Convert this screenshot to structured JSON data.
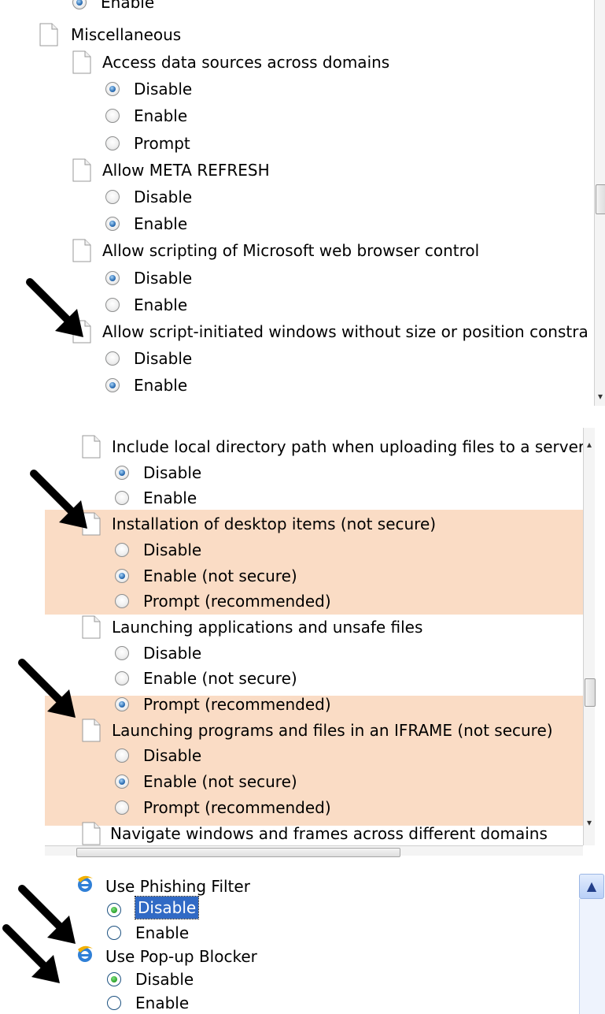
{
  "panel1": {
    "cut_top": "Enable",
    "category": "Miscellaneous",
    "settings": [
      {
        "title": "Access data sources across domains",
        "options": [
          "Disable",
          "Enable",
          "Prompt"
        ],
        "selected": 0
      },
      {
        "title": "Allow META REFRESH",
        "options": [
          "Disable",
          "Enable"
        ],
        "selected": 1
      },
      {
        "title": "Allow scripting of Microsoft web browser control",
        "options": [
          "Disable",
          "Enable"
        ],
        "selected": 0
      },
      {
        "title": "Allow script-initiated windows without size or position constra",
        "options": [
          "Disable",
          "Enable"
        ],
        "selected": 1
      }
    ]
  },
  "panel2": {
    "settings": [
      {
        "title": "Include local directory path when uploading files to a server",
        "options": [
          "Disable",
          "Enable"
        ],
        "selected": 0,
        "highlighted": false
      },
      {
        "title": "Installation of desktop items (not secure)",
        "options": [
          "Disable",
          "Enable (not secure)",
          "Prompt (recommended)"
        ],
        "selected": 1,
        "highlighted": true
      },
      {
        "title": "Launching applications and unsafe files",
        "options": [
          "Disable",
          "Enable (not secure)",
          "Prompt (recommended)"
        ],
        "selected": 2,
        "highlighted": false
      },
      {
        "title": "Launching programs and files in an IFRAME (not secure)",
        "options": [
          "Disable",
          "Enable (not secure)",
          "Prompt (recommended)"
        ],
        "selected": 1,
        "highlighted": true
      }
    ],
    "cut_bottom": "Navigate windows and frames across different domains",
    "highlight_color": "#fadcc5"
  },
  "panel3": {
    "settings": [
      {
        "title": "Use Phishing Filter",
        "options": [
          "Disable",
          "Enable"
        ],
        "selected": 0,
        "focused_option": 0
      },
      {
        "title": "Use Pop-up Blocker",
        "options": [
          "Disable",
          "Enable"
        ],
        "selected": 0
      }
    ],
    "icon": "ie-icon"
  }
}
